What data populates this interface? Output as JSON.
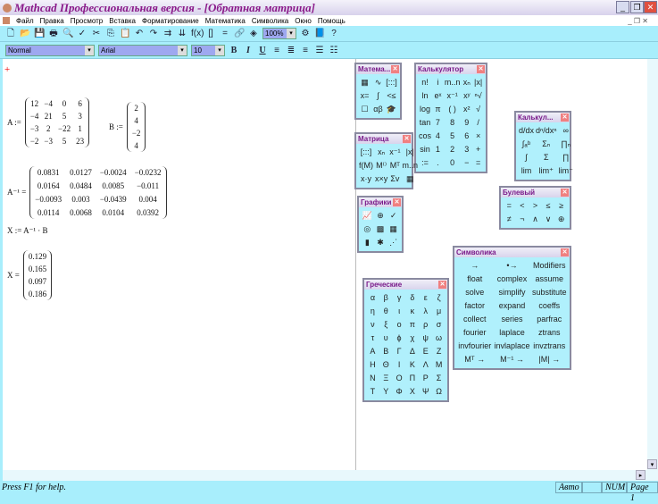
{
  "window": {
    "title": "Mathcad Профессиональная версия - [Обратная матрица]",
    "min": "_",
    "restore": "❐",
    "close": "✕"
  },
  "menu": [
    "Файл",
    "Правка",
    "Просмотр",
    "Вставка",
    "Форматирование",
    "Математика",
    "Символика",
    "Окно",
    "Помощь"
  ],
  "toolbar": {
    "icons": [
      "new-icon",
      "open-icon",
      "save-icon",
      "print-icon",
      "print-preview-icon",
      "spellcheck-icon",
      "cut-icon",
      "copy-icon",
      "paste-icon",
      "undo-icon",
      "redo-icon",
      "align-across-icon",
      "align-down-icon",
      "insert-function-icon",
      "insert-unit-icon",
      "calculate-icon",
      "insert-hyperlink-icon",
      "component-wizard-icon",
      "run-icon",
      "resources-icon",
      "help-icon"
    ],
    "glyphs": [
      "🗋",
      "📂",
      "💾",
      "🖶",
      "🔍",
      "✓",
      "✂",
      "⎘",
      "📋",
      "↶",
      "↷",
      "⇉",
      "⇊",
      "f(x)",
      "[]",
      "=",
      "🔗",
      "◈",
      "⚙",
      "📘",
      "?"
    ],
    "zoom": "100%"
  },
  "format": {
    "style": "Normal",
    "font": "Arial",
    "size": "10",
    "bold": "B",
    "italic": "I",
    "underline": "U",
    "glyphs": [
      "≡",
      "≣",
      "≡",
      "☰",
      "☷"
    ]
  },
  "worksheet": {
    "crosshair": "+",
    "A_label": "A :=",
    "A": [
      [
        "12",
        "−4",
        "0",
        "6"
      ],
      [
        "−4",
        "21",
        "5",
        "3"
      ],
      [
        "−3",
        "2",
        "−22",
        "1"
      ],
      [
        "−2",
        "−3",
        "5",
        "23"
      ]
    ],
    "B_label": "B :=",
    "B": [
      "2",
      "4",
      "−2",
      "4"
    ],
    "Ainv_label": "A⁻¹ =",
    "Ainv": [
      [
        "0.0831",
        "0.0127",
        "−0.0024",
        "−0.0232"
      ],
      [
        "0.0164",
        "0.0484",
        "0.0085",
        "−0.011"
      ],
      [
        "−0.0093",
        "0.003",
        "−0.0439",
        "0.004"
      ],
      [
        "0.0114",
        "0.0068",
        "0.0104",
        "0.0392"
      ]
    ],
    "X_def": "X := A⁻¹ · B",
    "X_label": "X =",
    "X": [
      "0.129",
      "0.165",
      "0.097",
      "0.186"
    ]
  },
  "palettes": {
    "math": {
      "title": "Матема...",
      "items": [
        "▦",
        "∿",
        "[:::]",
        "x=",
        "∫",
        "<≤",
        "☐",
        "αβ",
        "🎓"
      ]
    },
    "calc": {
      "title": "Калькулятор",
      "items": [
        "n!",
        "i",
        "m..n",
        "xₙ",
        "|x|",
        "ln",
        "eˣ",
        "x⁻¹",
        "xʸ",
        "ⁿ√",
        "log",
        "π",
        "( )",
        "x²",
        "√",
        "tan",
        "7",
        "8",
        "9",
        "/",
        "cos",
        "4",
        "5",
        "6",
        "×",
        "sin",
        "1",
        "2",
        "3",
        "+",
        ":=",
        ".",
        "0",
        "−",
        "="
      ]
    },
    "matrix": {
      "title": "Матрица",
      "items": [
        "[:::]",
        "xₙ",
        "x⁻¹",
        "|x|",
        "f(M)",
        "M⁽⁾",
        "Mᵀ",
        "m..n",
        "x·y",
        "x×y",
        "Σv",
        "▦"
      ]
    },
    "calculus": {
      "title": "Калькул...",
      "items": [
        "d/dx",
        "dⁿ/dxⁿ",
        "∞",
        "∫ₐᵇ",
        "Σₙ",
        "∏ₙ",
        "∫",
        "Σ",
        "∏",
        "lim",
        "lim⁺",
        "lim⁻"
      ]
    },
    "boolean": {
      "title": "Булевый",
      "items": [
        "=",
        "<",
        ">",
        "≤",
        "≥",
        "≠",
        "¬",
        "∧",
        "∨",
        "⊕"
      ]
    },
    "graph": {
      "title": "Графики",
      "items": [
        "📈",
        "⊕",
        "✓",
        "◎",
        "▩",
        "▦",
        "▮",
        "✱",
        "⋰"
      ]
    },
    "symbolic": {
      "title": "Символика",
      "items": [
        "→",
        "•→",
        "Modifiers",
        "float",
        "complex",
        "assume",
        "solve",
        "simplify",
        "substitute",
        "factor",
        "expand",
        "coeffs",
        "collect",
        "series",
        "parfrac",
        "fourier",
        "laplace",
        "ztrans",
        "invfourier",
        "invlaplace",
        "invztrans",
        "Mᵀ →",
        "M⁻¹ →",
        "|M| →"
      ]
    },
    "greek": {
      "title": "Греческие",
      "items": [
        "α",
        "β",
        "γ",
        "δ",
        "ε",
        "ζ",
        "η",
        "θ",
        "ι",
        "κ",
        "λ",
        "μ",
        "ν",
        "ξ",
        "ο",
        "π",
        "ρ",
        "σ",
        "τ",
        "υ",
        "ϕ",
        "χ",
        "ψ",
        "ω",
        "Α",
        "Β",
        "Γ",
        "Δ",
        "Ε",
        "Ζ",
        "Η",
        "Θ",
        "Ι",
        "Κ",
        "Λ",
        "Μ",
        "Ν",
        "Ξ",
        "Ο",
        "Π",
        "Ρ",
        "Σ",
        "Τ",
        "Υ",
        "Φ",
        "Χ",
        "Ψ",
        "Ω"
      ]
    }
  },
  "status": {
    "help": "Press F1 for help.",
    "mode": "Авто",
    "num": "NUM",
    "page": "Page 1"
  },
  "colors": {
    "accent": "#a8eefc",
    "title_text": "#8a1a8a",
    "palette_bg": "#b0f0fc"
  }
}
